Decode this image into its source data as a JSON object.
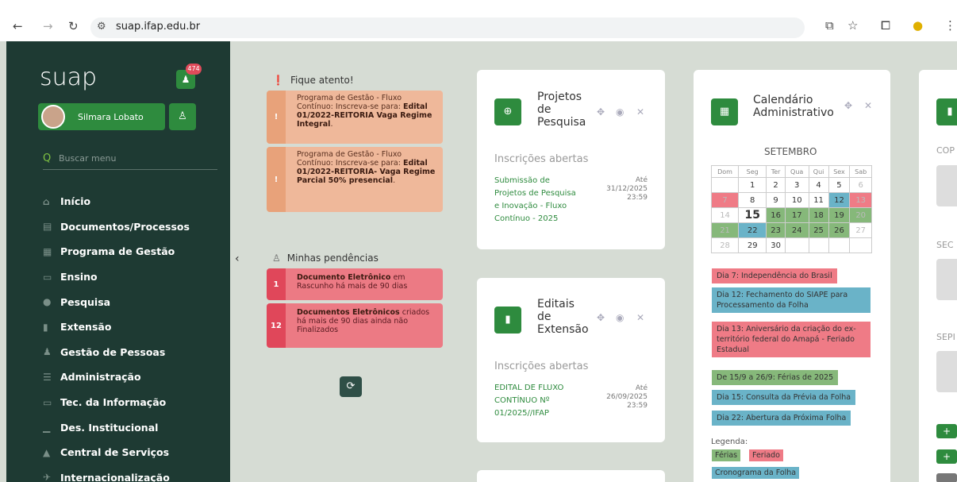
{
  "browser": {
    "url": "suap.ifap.edu.br"
  },
  "sidebar": {
    "logo": "suap",
    "notif_count": "474",
    "user": "Silmara Lobato",
    "search_placeholder": "Buscar menu",
    "items": [
      {
        "label": "Início",
        "icon": "home-icon"
      },
      {
        "label": "Documentos/Processos",
        "icon": "document-icon"
      },
      {
        "label": "Programa de Gestão",
        "icon": "briefcase-icon"
      },
      {
        "label": "Ensino",
        "icon": "board-icon"
      },
      {
        "label": "Pesquisa",
        "icon": "globe-icon"
      },
      {
        "label": "Extensão",
        "icon": "building-icon"
      },
      {
        "label": "Gestão de Pessoas",
        "icon": "people-icon"
      },
      {
        "label": "Administração",
        "icon": "list-icon"
      },
      {
        "label": "Tec. da Informação",
        "icon": "monitor-icon"
      },
      {
        "label": "Des. Institucional",
        "icon": "chart-icon"
      },
      {
        "label": "Central de Serviços",
        "icon": "cone-icon"
      },
      {
        "label": "Internacionalização",
        "icon": "plane-icon"
      }
    ]
  },
  "alerts": {
    "title": "Fique atento!",
    "items": [
      {
        "text": "Programa de Gestão - Fluxo Contínuo: Inscreva-se para:",
        "bold": "Edital 01/2022-REITORIA Vaga Regime Integral",
        "tail": "."
      },
      {
        "text": "Programa de Gestão - Fluxo Contínuo: Inscreva-se para:",
        "bold": "Edital 01/2022-REITORIA- Vaga Regime Parcial 50% presencial",
        "tail": "."
      }
    ]
  },
  "pendencias": {
    "title": "Minhas pendências",
    "items": [
      {
        "count": "1",
        "bold": "Documento Eletrônico",
        "text": " em Rascunho há mais de 90 dias"
      },
      {
        "count": "12",
        "bold": "Documentos Eletrônicos",
        "text": " criados há mais de 90 dias ainda não Finalizados"
      }
    ]
  },
  "projetos": {
    "title_lines": [
      "Projetos",
      "de",
      "Pesquisa"
    ],
    "subtitle": "Inscrições abertas",
    "link_lines": [
      "Submissão de",
      "Projetos de Pesquisa",
      "e Inovação - Fluxo",
      "Contínuo - 2025"
    ],
    "date_lines": [
      "Até",
      "31/12/2025",
      "23:59"
    ]
  },
  "editais": {
    "title_lines": [
      "Editais",
      "de",
      "Extensão"
    ],
    "subtitle": "Inscrições abertas",
    "link_lines": [
      "EDITAL DE FLUXO",
      "CONTÍNUO Nº",
      "01/2025//IFAP"
    ],
    "date_lines": [
      "Até",
      "26/09/2025",
      "23:59"
    ]
  },
  "calendario": {
    "title_lines": [
      "Calendário",
      "Administrativo"
    ],
    "month": "SETEMBRO",
    "weekdays": [
      "Dom",
      "Seg",
      "Ter",
      "Qua",
      "Qui",
      "Sex",
      "Sab"
    ],
    "events": [
      "Dia 7: Independência do Brasil",
      "Dia 12: Fechamento do SIAPE para Processamento da Folha",
      "Dia 13: Aniversário da criação do ex-território federal do Amapá - Feriado Estadual",
      "De 15/9 a 26/9: Férias de 2025",
      "Dia 15: Consulta da Prévia da Folha",
      "Dia 22: Abertura da Próxima Folha"
    ],
    "legend_title": "Legenda:",
    "legend": [
      "Férias",
      "Feriado",
      "Cronograma da Folha"
    ],
    "colors": {
      "ferias": "#86b87a",
      "feriado": "#ef7b86",
      "folha": "#6ab3c8"
    }
  },
  "right_partial": {
    "labels": [
      "COP",
      "SEC",
      "SEPI"
    ]
  }
}
